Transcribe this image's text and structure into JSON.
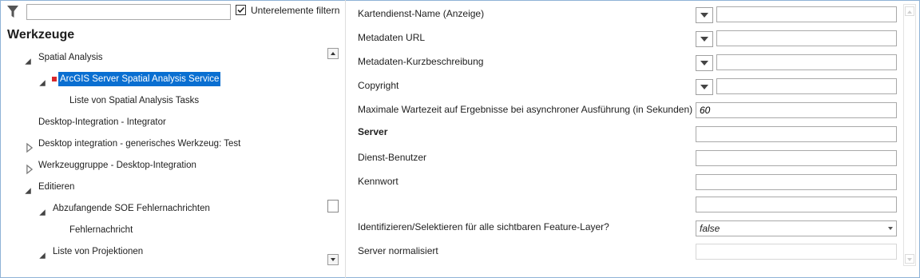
{
  "filter": {
    "value": "",
    "checkbox_label": "Unterelemente filtern",
    "checkbox_checked": true
  },
  "panel": {
    "title": "Werkzeuge"
  },
  "tree": [
    {
      "label": "Spatial Analysis",
      "state": "expanded"
    },
    {
      "label": "ArcGIS Server Spatial Analysis Service",
      "state": "expanded",
      "selected": true,
      "marker": "red"
    },
    {
      "label": "Liste von Spatial Analysis Tasks",
      "state": "leaf"
    },
    {
      "label": "Desktop-Integration - Integrator",
      "state": "leaf"
    },
    {
      "label": "Desktop integration - generisches Werkzeug: Test",
      "state": "collapsed"
    },
    {
      "label": "Werkzeuggruppe - Desktop-Integration",
      "state": "collapsed"
    },
    {
      "label": "Editieren",
      "state": "expanded"
    },
    {
      "label": "Abzufangende SOE Fehlernachrichten",
      "state": "expanded"
    },
    {
      "label": "Fehlernachricht",
      "state": "leaf"
    },
    {
      "label": "Liste von Projektionen",
      "state": "expanded"
    }
  ],
  "properties": [
    {
      "label": "Kartendienst-Name (Anzeige)",
      "value": "",
      "dropdown": true
    },
    {
      "label": "Metadaten URL",
      "value": "",
      "dropdown": true
    },
    {
      "label": "Metadaten-Kurzbeschreibung",
      "value": "",
      "dropdown": true
    },
    {
      "label": "Copyright",
      "value": "",
      "dropdown": true
    },
    {
      "label": "Maximale Wartezeit auf Ergebnisse bei asynchroner Ausführung (in Sekunden)",
      "value": "60"
    },
    {
      "label": "Server",
      "value": "",
      "bold": true
    },
    {
      "label": "Dienst-Benutzer",
      "value": ""
    },
    {
      "label": "Kennwort",
      "value": ""
    },
    {
      "label": "",
      "value": ""
    },
    {
      "label": "Identifizieren/Selektieren für alle sichtbaren Feature-Layer?",
      "value": "false",
      "combo": true
    },
    {
      "label": "Server normalisiert",
      "value": "",
      "disabled": true
    }
  ],
  "colors": {
    "selection": "#0a6fd1",
    "marker": "#d8282b",
    "border": "#8fb2d6"
  }
}
